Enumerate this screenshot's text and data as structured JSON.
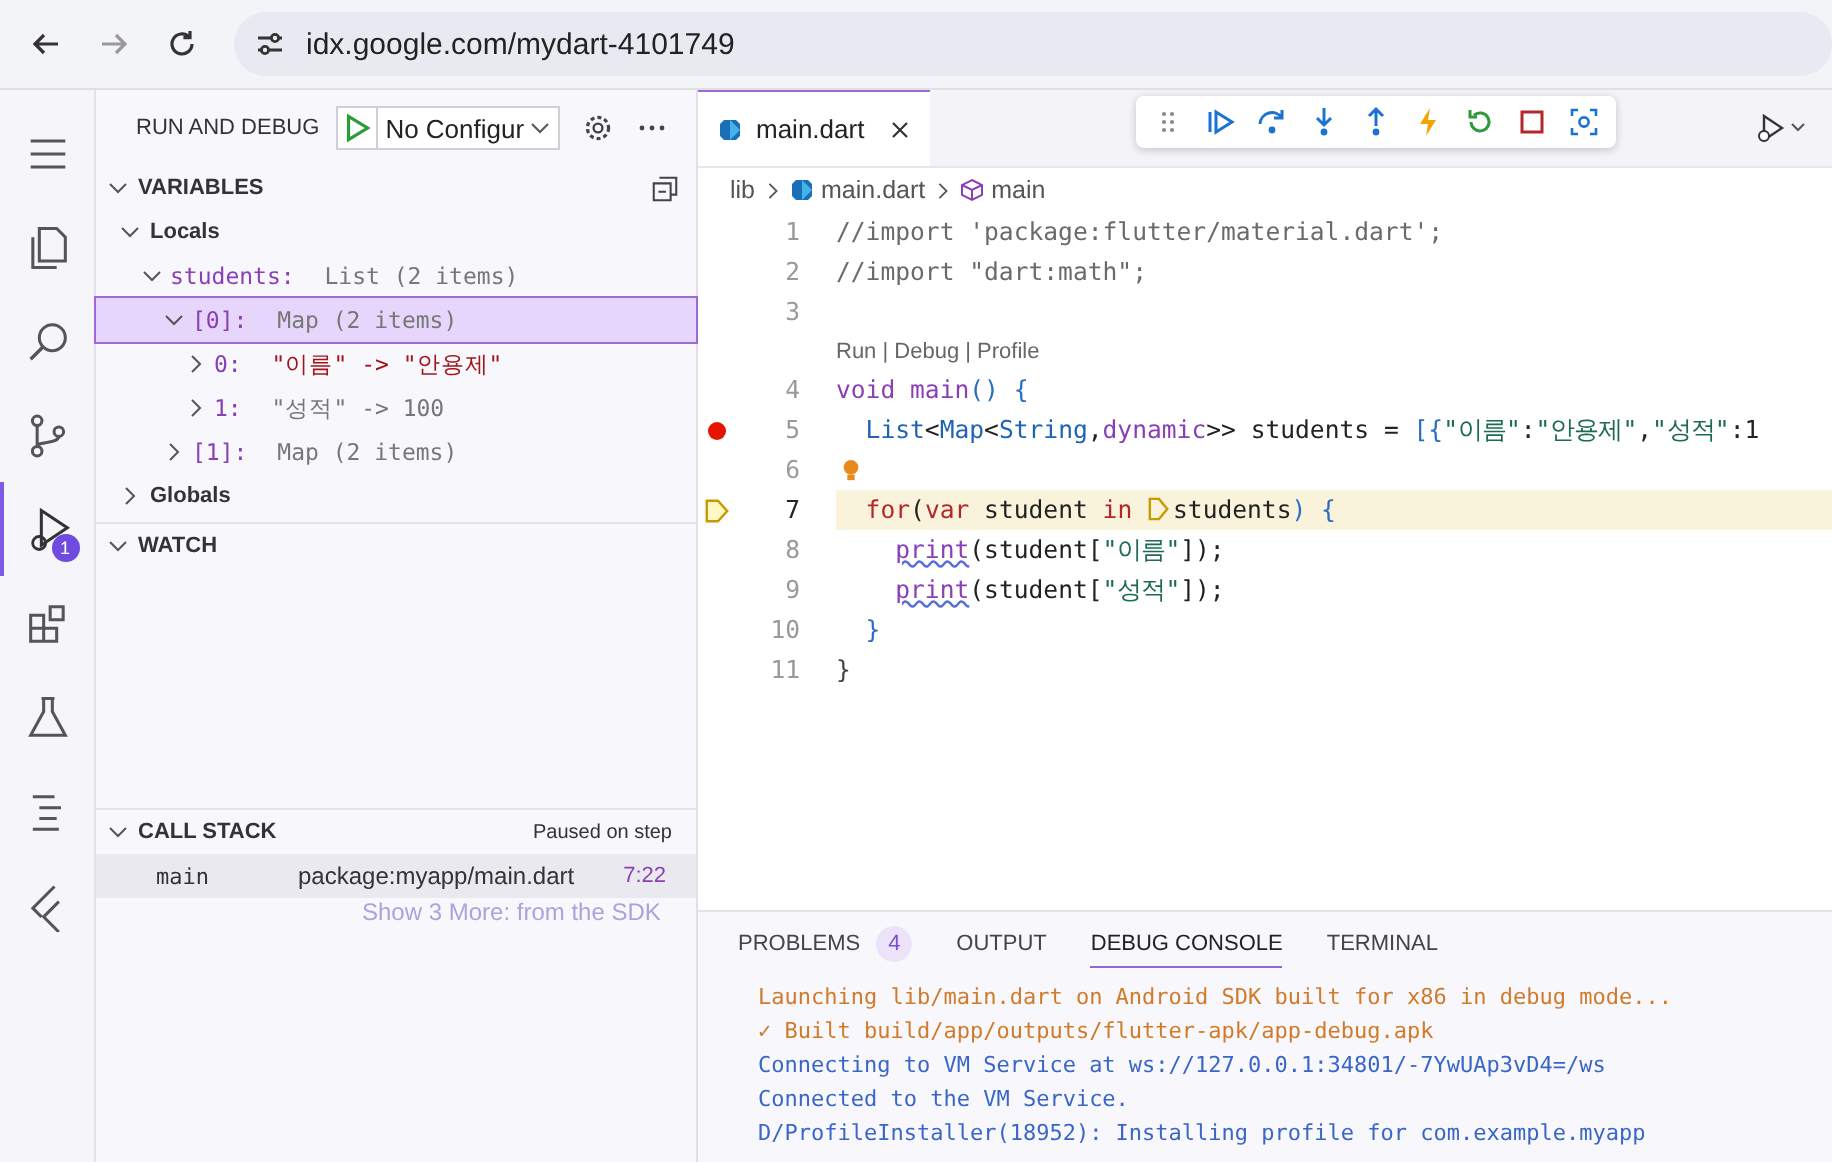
{
  "browser": {
    "url": "idx.google.com/mydart-4101749"
  },
  "activity_bar": [
    {
      "kind": "menu",
      "selected": false
    },
    {
      "kind": "files",
      "selected": false
    },
    {
      "kind": "search",
      "selected": false
    },
    {
      "kind": "source-control",
      "selected": false
    },
    {
      "kind": "debug",
      "selected": true,
      "badge": "1"
    },
    {
      "kind": "extensions",
      "selected": false
    },
    {
      "kind": "flask",
      "selected": false
    },
    {
      "kind": "outline",
      "selected": false
    },
    {
      "kind": "flutter",
      "selected": false
    }
  ],
  "sidebar": {
    "title": "RUN AND DEBUG",
    "configuration": "No Configur",
    "variables": {
      "title": "VARIABLES",
      "scopes": [
        {
          "label": "Locals",
          "expanded": true,
          "children": [
            {
              "name": "students:",
              "value": "List (2 items)",
              "kind": "plain",
              "expanded": true,
              "selected": false,
              "children": [
                {
                  "name": "[0]:",
                  "value": "Map (2 items)",
                  "kind": "plain",
                  "expanded": true,
                  "selected": true,
                  "children": [
                    {
                      "name": "0:",
                      "value": "\"이름\" -> \"안용제\"",
                      "kind": "string",
                      "expanded": false,
                      "selected": false
                    },
                    {
                      "name": "1:",
                      "value": "\"성적\" -> 100",
                      "kind": "plain",
                      "expanded": false,
                      "selected": false
                    }
                  ]
                },
                {
                  "name": "[1]:",
                  "value": "Map (2 items)",
                  "kind": "plain",
                  "expanded": false,
                  "selected": false
                }
              ]
            }
          ]
        },
        {
          "label": "Globals",
          "expanded": false
        }
      ]
    },
    "watch": {
      "title": "WATCH"
    },
    "call_stack": {
      "title": "CALL STACK",
      "status": "Paused on step",
      "frames": [
        {
          "name": "main",
          "source": "package:myapp/main.dart",
          "position": "7:22"
        }
      ],
      "more": "Show 3 More: from the SDK"
    }
  },
  "editor": {
    "tabs": [
      {
        "label": "main.dart",
        "selected": true
      }
    ],
    "breadcrumb": [
      "lib",
      "main.dart",
      "main"
    ],
    "lines": [
      {
        "kind": "code",
        "number": "1",
        "tokens": [
          {
            "text": "//import 'package:flutter/material.dart';",
            "kind": "comment"
          }
        ]
      },
      {
        "kind": "code",
        "number": "2",
        "tokens": [
          {
            "text": "//import \"dart:math\";",
            "kind": "comment"
          }
        ]
      },
      {
        "kind": "code",
        "number": "3"
      },
      {
        "kind": "codelens",
        "text": "Run | Debug | Profile"
      },
      {
        "kind": "code",
        "number": "4",
        "tokens": [
          {
            "text": "void ",
            "kind": "keyword"
          },
          {
            "text": "main",
            "kind": "function"
          },
          {
            "text": "() {",
            "kind": "punct"
          }
        ]
      },
      {
        "kind": "code",
        "number": "5",
        "breakpoint": true,
        "tokens": [
          {
            "text": "  List",
            "kind": "type"
          },
          {
            "text": "<",
            "kind": "plain"
          },
          {
            "text": "Map",
            "kind": "type"
          },
          {
            "text": "<",
            "kind": "plain"
          },
          {
            "text": "String",
            "kind": "type"
          },
          {
            "text": ",",
            "kind": "plain"
          },
          {
            "text": "dynamic",
            "kind": "keyword"
          },
          {
            "text": ">> students = ",
            "kind": "plain"
          },
          {
            "text": "[{",
            "kind": "punct"
          },
          {
            "text": "\"이름\"",
            "kind": "string"
          },
          {
            "text": ":",
            "kind": "plain"
          },
          {
            "text": "\"안용제\"",
            "kind": "string"
          },
          {
            "text": ",",
            "kind": "plain"
          },
          {
            "text": "\"성적\"",
            "kind": "string"
          },
          {
            "text": ":1",
            "kind": "plain"
          }
        ]
      },
      {
        "kind": "code",
        "number": "6",
        "lightbulb": true
      },
      {
        "kind": "code",
        "number": "7",
        "current": true,
        "tokens": [
          {
            "text": "  for",
            "kind": "control"
          },
          {
            "text": "(",
            "kind": "plain"
          },
          {
            "text": "var",
            "kind": "control"
          },
          {
            "text": " student ",
            "kind": "plain"
          },
          {
            "text": "in ",
            "kind": "control"
          },
          {
            "kind": "frame"
          },
          {
            "text": "students",
            "kind": "plain"
          },
          {
            "text": ") {",
            "kind": "punct"
          }
        ]
      },
      {
        "kind": "code",
        "number": "8",
        "tokens": [
          {
            "text": "    print",
            "kind": "warning"
          },
          {
            "text": "(student[",
            "kind": "plain"
          },
          {
            "text": "\"이름\"",
            "kind": "string"
          },
          {
            "text": "]);",
            "kind": "plain"
          }
        ]
      },
      {
        "kind": "code",
        "number": "9",
        "tokens": [
          {
            "text": "    print",
            "kind": "warning"
          },
          {
            "text": "(student[",
            "kind": "plain"
          },
          {
            "text": "\"성적\"",
            "kind": "string"
          },
          {
            "text": "]);",
            "kind": "plain"
          }
        ]
      },
      {
        "kind": "code",
        "number": "10",
        "tokens": [
          {
            "text": "  }",
            "kind": "punct"
          }
        ]
      },
      {
        "kind": "code",
        "number": "11",
        "tokens": [
          {
            "text": "}",
            "kind": "punct2"
          }
        ]
      }
    ]
  },
  "panel": {
    "tabs": [
      {
        "label": "PROBLEMS",
        "badge": "4",
        "selected": false
      },
      {
        "label": "OUTPUT",
        "selected": false
      },
      {
        "label": "DEBUG CONSOLE",
        "selected": true
      },
      {
        "label": "TERMINAL",
        "selected": false
      }
    ],
    "console": [
      {
        "text": "Launching lib/main.dart on Android SDK built for x86 in debug mode...",
        "kind": "info"
      },
      {
        "text": "✓ Built build/app/outputs/flutter-apk/app-debug.apk",
        "kind": "info"
      },
      {
        "text": "Connecting to VM Service at ws://127.0.0.1:34801/-7YwUAp3vD4=/ws",
        "kind": "log"
      },
      {
        "text": "Connected to the VM Service.",
        "kind": "log"
      },
      {
        "text": "D/ProfileInstaller(18952): Installing profile for com.example.myapp",
        "kind": "log"
      }
    ]
  }
}
